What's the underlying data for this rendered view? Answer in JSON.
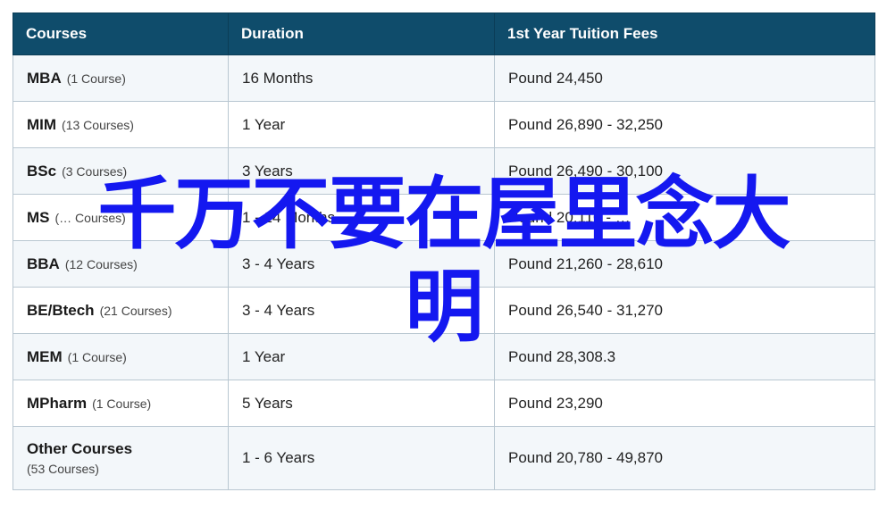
{
  "table": {
    "headers": [
      "Courses",
      "Duration",
      "1st Year Tuition Fees"
    ],
    "rows": [
      {
        "course": "MBA",
        "count": "(1 Course)",
        "duration": "16 Months",
        "fees": "Pound 24,450"
      },
      {
        "course": "MIM",
        "count": "(13 Courses)",
        "duration": "1 Year",
        "fees": "Pound 26,890 - 32,250"
      },
      {
        "course": "BSc",
        "count": "(3 Courses)",
        "duration": "3 Years",
        "fees": "Pound 26,490 - 30,100"
      },
      {
        "course": "MS",
        "count": "(… Courses)",
        "duration": "1 - 24 Months",
        "fees": "Pound 20,110 - …"
      },
      {
        "course": "BBA",
        "count": "(12 Courses)",
        "duration": "3 - 4 Years",
        "fees": "Pound 21,260 - 28,610"
      },
      {
        "course": "BE/Btech",
        "count": "(21 Courses)",
        "duration": "3 - 4 Years",
        "fees": "Pound 26,540 - 31,270"
      },
      {
        "course": "MEM",
        "count": "(1 Course)",
        "duration": "1 Year",
        "fees": "Pound 28,308.3"
      },
      {
        "course": "MPharm",
        "count": "(1 Course)",
        "duration": "5 Years",
        "fees": "Pound 23,290"
      },
      {
        "course": "Other Courses",
        "count": "(53 Courses)",
        "duration": "1 - 6 Years",
        "fees": "Pound 20,780 - 49,870"
      }
    ]
  },
  "overlay": {
    "line1": "千万不要在屋里念大",
    "line2": "明",
    "color": "#1418f0"
  }
}
